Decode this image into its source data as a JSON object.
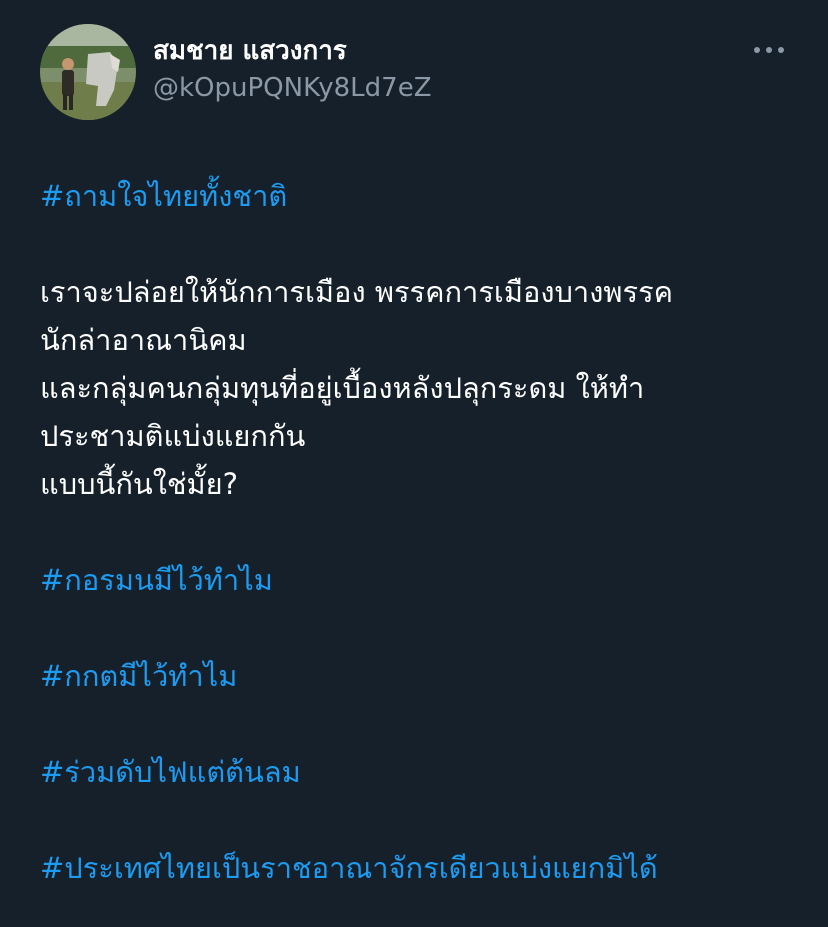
{
  "author": {
    "display_name": "สมชาย แสวงการ",
    "handle": "@kOpuPQNKy8Ld7eZ"
  },
  "menu": {
    "icon": "more-horizontal-icon"
  },
  "tweet": {
    "hashtag_1": "#ถามใจไทยทั้งชาติ",
    "body_lines": [
      "เราจะปล่อยให้นักการเมือง พรรคการเมืองบางพรรค",
      "นักล่าอาณานิคม",
      "และกลุ่มคนกลุ่มทุนที่อยู่เบื้องหลังปลุกระดม ให้ทำ",
      "ประชามติแบ่งแยกกัน",
      "แบบนี้กันใช่มั้ย?"
    ],
    "hashtag_2": "#กอรมนมีไว้ทำไม",
    "hashtag_3": "#กกตมีไว้ทำไม",
    "hashtag_4": "#ร่วมดับไฟแต่ต้นลม",
    "hashtag_5": "#ประเทศไทยเป็นราชอาณาจักรเดียวแบ่งแยกมิได้"
  },
  "colors": {
    "background": "#15202b",
    "text": "#ffffff",
    "secondary_text": "#8b98a5",
    "hashtag": "#1d9bf0"
  }
}
